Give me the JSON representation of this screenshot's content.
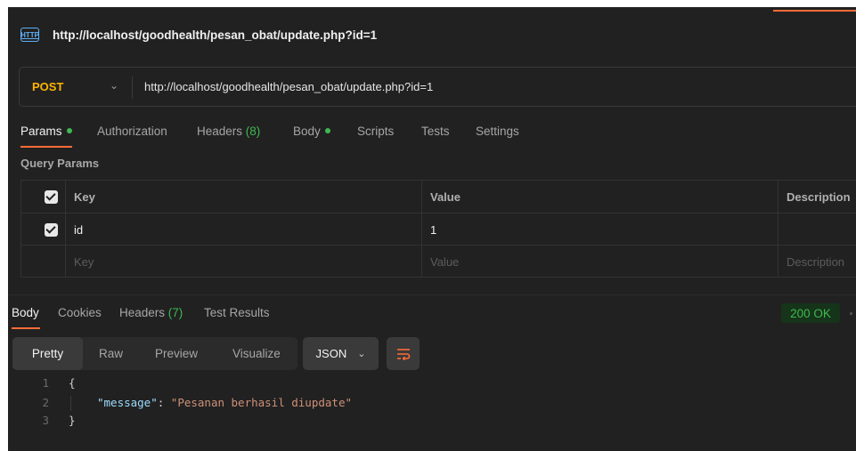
{
  "request": {
    "title": "http://localhost/goodhealth/pesan_obat/update.php?id=1",
    "icon": "http-icon",
    "icon_text": "HTTP",
    "method": "POST",
    "url": "http://localhost/goodhealth/pesan_obat/update.php?id=1"
  },
  "request_tabs": {
    "params": "Params",
    "authorization": "Authorization",
    "headers": "Headers",
    "headers_count": "(8)",
    "body": "Body",
    "scripts": "Scripts",
    "tests": "Tests",
    "settings": "Settings"
  },
  "query_params": {
    "label": "Query Params",
    "columns": {
      "key": "Key",
      "value": "Value",
      "description": "Description"
    },
    "rows": [
      {
        "checked": true,
        "key": "id",
        "value": "1",
        "description": ""
      }
    ],
    "placeholders": {
      "key": "Key",
      "value": "Value",
      "description": "Description"
    }
  },
  "response_tabs": {
    "body": "Body",
    "cookies": "Cookies",
    "headers": "Headers",
    "headers_count": "(7)",
    "test_results": "Test Results"
  },
  "status": {
    "text": "200 OK",
    "color": "#3fb950"
  },
  "view_modes": {
    "pretty": "Pretty",
    "raw": "Raw",
    "preview": "Preview",
    "visualize": "Visualize",
    "format": "JSON"
  },
  "response_body": {
    "lines": [
      {
        "n": "1",
        "open": "{"
      },
      {
        "n": "2",
        "key": "\"message\"",
        "sep": ": ",
        "value": "\"Pesanan berhasil diupdate\""
      },
      {
        "n": "3",
        "close": "}"
      }
    ]
  },
  "colors": {
    "accent": "#ff6c37",
    "method": "#ffb400",
    "background": "#212121"
  }
}
